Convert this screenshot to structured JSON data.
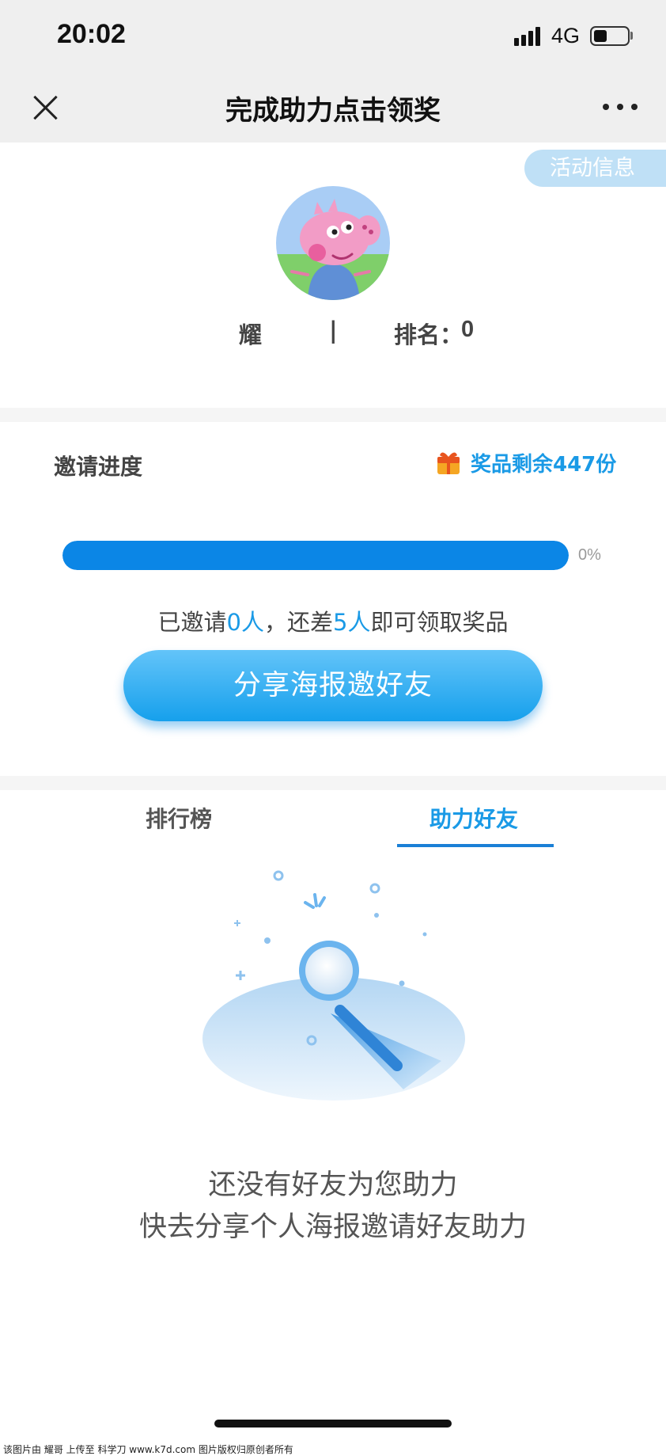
{
  "status_bar": {
    "time": "20:02",
    "network": "4G",
    "battery_level": 0.4
  },
  "nav": {
    "title": "完成助力点击领奖",
    "close_icon": "close-icon",
    "more_icon": "more-icon"
  },
  "profile": {
    "activity_info_label": "活动信息",
    "avatar_icon": "avatar-peppa-pig",
    "name": "耀",
    "separator": "|",
    "rank_label": "排名：",
    "rank_value": "0"
  },
  "invite": {
    "title": "邀请进度",
    "prize_icon": "gift-box-icon",
    "prize_remaining": "奖品剩余447份",
    "progress_fraction": 1.0,
    "progress_percent_text": "0%",
    "status_prefix": "已邀请",
    "invited_count": "0人",
    "status_middle": "，还差",
    "remaining_count": "5人",
    "status_suffix": "即可领取奖品",
    "share_button": "分享海报邀好友"
  },
  "tabs": [
    {
      "label": "排行榜",
      "active": false
    },
    {
      "label": "助力好友",
      "active": true
    }
  ],
  "empty_state": {
    "illustration_icon": "magnifier-empty-icon",
    "line1": "还没有好友为您助力",
    "line2": "快去分享个人海报邀请好友助力"
  },
  "footer": {
    "watermark": "该图片由 耀哥 上传至 科学刀 www.k7d.com 图片版权归原创者所有"
  },
  "colors": {
    "accent": "#1a9ae6",
    "progress_fill": "#0b86e6",
    "header_bg": "#efefef"
  }
}
